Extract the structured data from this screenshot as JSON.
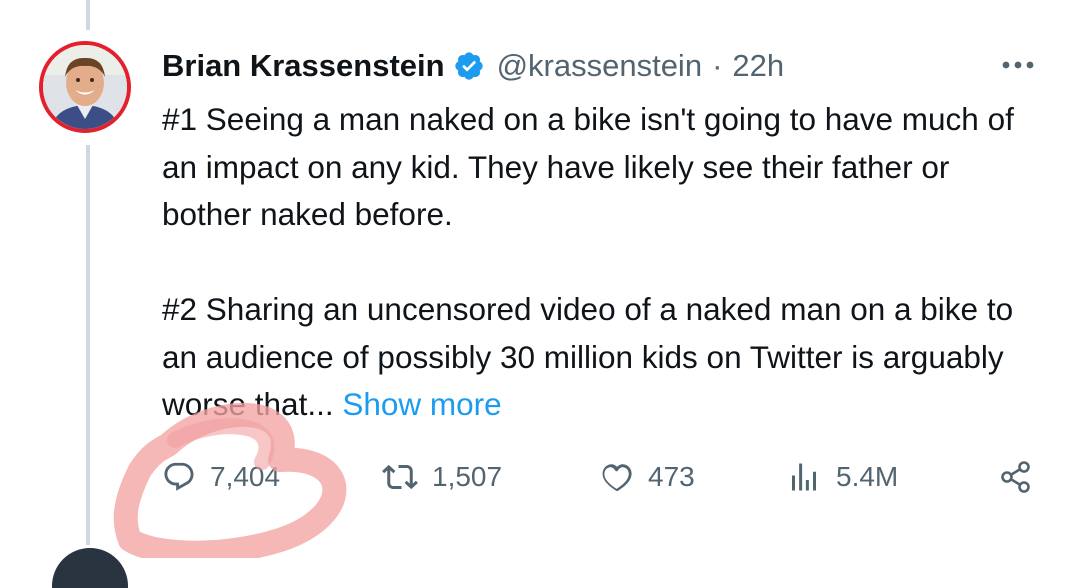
{
  "tweet": {
    "author_name": "Brian Krassenstein",
    "verified_icon": "verified-badge-icon",
    "handle": "@krassenstein",
    "separator": "·",
    "time": "22h",
    "paragraph1": "#1 Seeing a man naked on a bike isn't going to have much of an impact on any kid.  They have likely see their father or bother naked before.",
    "paragraph2": "#2 Sharing an uncensored video of a naked man on a bike to an audience of possibly 30 million kids on Twitter is arguably worse that...",
    "show_more": "Show more"
  },
  "actions": {
    "replies": "7,404",
    "reposts": "1,507",
    "likes": "473",
    "views": "5.4M"
  },
  "icons": {
    "more": "more-options-icon",
    "reply": "reply-icon",
    "repost": "repost-icon",
    "like": "heart-icon",
    "views": "views-icon",
    "share": "share-icon"
  },
  "colors": {
    "text": "#0f1419",
    "secondary": "#536471",
    "link": "#1d9bf0",
    "avatar_ring": "#e3202b",
    "annotation": "#f4a3a3"
  }
}
